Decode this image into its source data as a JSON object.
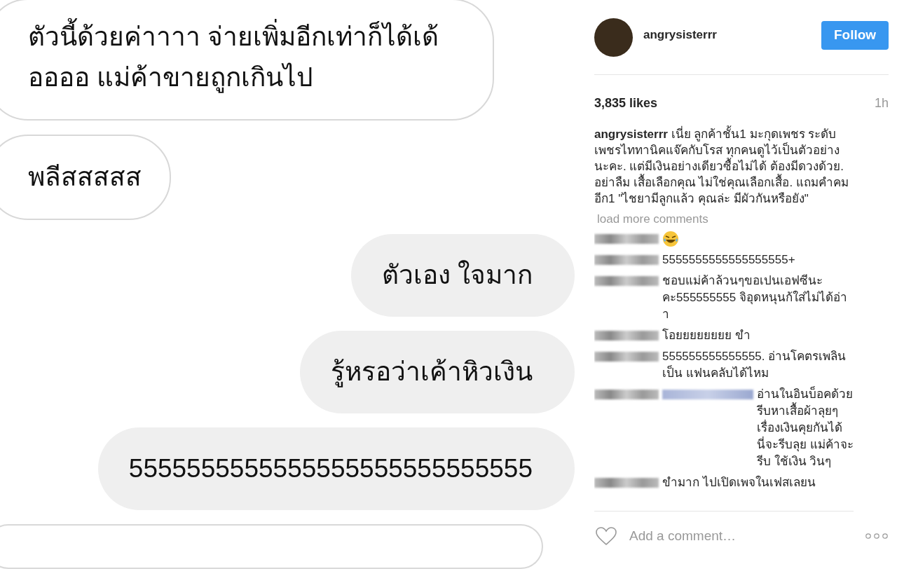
{
  "chat": {
    "messages": [
      {
        "outgoing": false,
        "text": "ตัวนี้ด้วยค่าาาา จ่ายเพิ่มอีกเท่าก็ได้เด้ออออ แม่ค้าขายถูกเกินไป"
      },
      {
        "outgoing": false,
        "text": "พลีสสสสส"
      },
      {
        "outgoing": true,
        "text": "ตัวเอง ใจมาก"
      },
      {
        "outgoing": true,
        "text": "รู้หรอว่าเค้าหิวเงิน"
      },
      {
        "outgoing": true,
        "text": "5555555555555555555555555555"
      },
      {
        "outgoing": false
      }
    ]
  },
  "post": {
    "author": "angrysisterrr",
    "follow_button": "Follow",
    "likes": "3,835 likes",
    "time": "1h",
    "caption": "**angrysisterrr** เนี่ย ลูกค้าชั้น1 มะกุดเพชร ระดับเพชรไททานิคแจ๊คกับโรส ทุกคนดูไว้เป็นตัวอย่างนะคะ. แต่มีเงินอย่างเดียวซื้อไม่ได้ ต้องมีดวงด้วย. อย่าลืม เสื้อเลือกคุณ ไม่ใช่คุณเลือกเสื้อ. แถมคำคมอีก1 \"ไชยามีลูกแล้ว คุณล่ะ มีผัวกันหรือยัง\"",
    "load_more": "load more comments",
    "comments": [
      {
        "kind": "emoji",
        "mention": false
      },
      {
        "kind": "text",
        "text": "5555555555555555555+",
        "mention": false
      },
      {
        "kind": "text",
        "text": "ชอบแม่ค้าล้วนๆขอเปนเอฟซีนะคะ555555555 จิอุดหนุนก้ใส่ไม่ได้อ่าา",
        "mention": false
      },
      {
        "kind": "text",
        "text": "โอยยยยยยยย ขำ",
        "mention": false
      },
      {
        "kind": "text",
        "text": "555555555555555. อ่านโคตรเพลิน เป็น แฟนคลับได้ไหม",
        "mention": false
      },
      {
        "kind": "text",
        "text": "อ่านในอินบ็อคด้วย รีบหาเสื้อผ้าลุยๆ เรื่องเงินคุยกันได้ นี่จะรีบลุย แม่ค้าจะรีบ ใช้เงิน วินๆ",
        "mention": true
      },
      {
        "kind": "text",
        "text": "ขำมาก ไปเปิดเพจในเฟสเลยน",
        "mention": false
      }
    ],
    "comment_field": {
      "placeholder": "Add a comment…"
    }
  }
}
